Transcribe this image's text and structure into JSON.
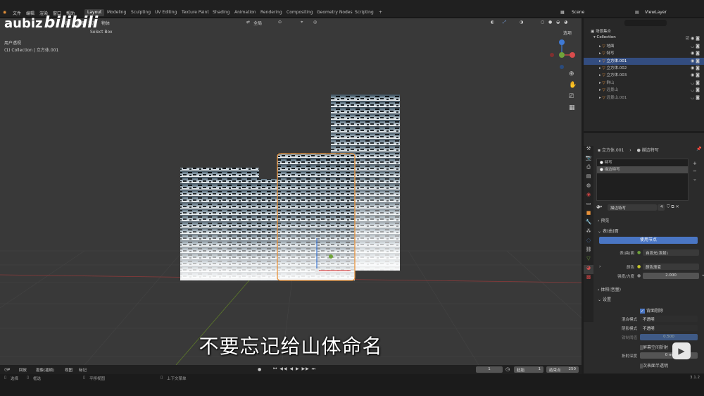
{
  "menus": [
    "文件",
    "编辑",
    "渲染",
    "窗口",
    "帮助"
  ],
  "workspaces": [
    "Layout",
    "Modeling",
    "Sculpting",
    "UV Editing",
    "Texture Paint",
    "Shading",
    "Animation",
    "Rendering",
    "Compositing",
    "Geometry Nodes",
    "Scripting"
  ],
  "active_workspace": "Layout",
  "scene_name": "Scene",
  "viewlayer_name": "ViewLayer",
  "watermark": {
    "user": "aubiz",
    "site": "bilibili"
  },
  "viewport": {
    "header_tools": [
      "视图",
      "选择",
      "添加",
      "物体"
    ],
    "select_box": "Select Box",
    "transform_orientation": "全局",
    "info_line1": "用户透视",
    "info_line2": "(1) Collection | 立方体.001",
    "viewport_option": "选项"
  },
  "outliner": {
    "root": "场景集合",
    "collection": "Collection",
    "items": [
      {
        "name": "地面",
        "selected": false
      },
      {
        "name": "特写",
        "selected": false
      },
      {
        "name": "立方体.001",
        "selected": true
      },
      {
        "name": "立方体.002",
        "selected": false
      },
      {
        "name": "立方体.003",
        "selected": false
      },
      {
        "name": "群山",
        "selected": false
      },
      {
        "name": "远景山",
        "selected": false
      },
      {
        "name": "远景山.001",
        "selected": false
      }
    ]
  },
  "properties": {
    "breadcrumb_object": "立方体.001",
    "breadcrumb_material": "描边特写",
    "material_slots": [
      "特写",
      "描边特写"
    ],
    "material_name": "描边特写",
    "user_count": "4",
    "sections": {
      "preview": "预览",
      "surface": "表(曲)面",
      "volume": "体积(音量)",
      "settings": "设置"
    },
    "use_nodes_button": "使用节点",
    "surface_label": "表(曲)面",
    "surface_value": "自发光(发射)",
    "color_label": "颜色",
    "color_value": "颜色渐变",
    "strength_label": "强度/力度",
    "strength_value": "2.000",
    "backface_label": "背面剔除",
    "blend_mode_label": "混合模式",
    "blend_mode_value": "不透明",
    "shadow_mode_label": "阴影模式",
    "shadow_mode_value": "不透明",
    "clip_label": "钳制阈值",
    "clip_value": "0.500",
    "screen_refraction_label": "屏幕空间折射",
    "refraction_depth_label": "折射深度",
    "refraction_depth_value": "0 m",
    "subsurface_label": "次表面半透明"
  },
  "timeline": {
    "playback": "回放",
    "keying": "抠像(插帧)",
    "view": "视图",
    "marker": "标记",
    "current_frame": "1",
    "start_label": "起始",
    "start_value": "1",
    "end_label": "结束点",
    "end_value": "250"
  },
  "status": {
    "select": "选择",
    "box_select": "框选",
    "rotate_view": "平移视图",
    "context_menu": "上下文菜单",
    "version": "3.1.2"
  },
  "subtitle": "不要忘记给山体命名",
  "colors": {
    "selection": "#334d80",
    "active_outline": "#e8923a",
    "x_axis": "#c74747",
    "y_axis": "#7ea33a",
    "z_axis": "#3f7ad6"
  }
}
